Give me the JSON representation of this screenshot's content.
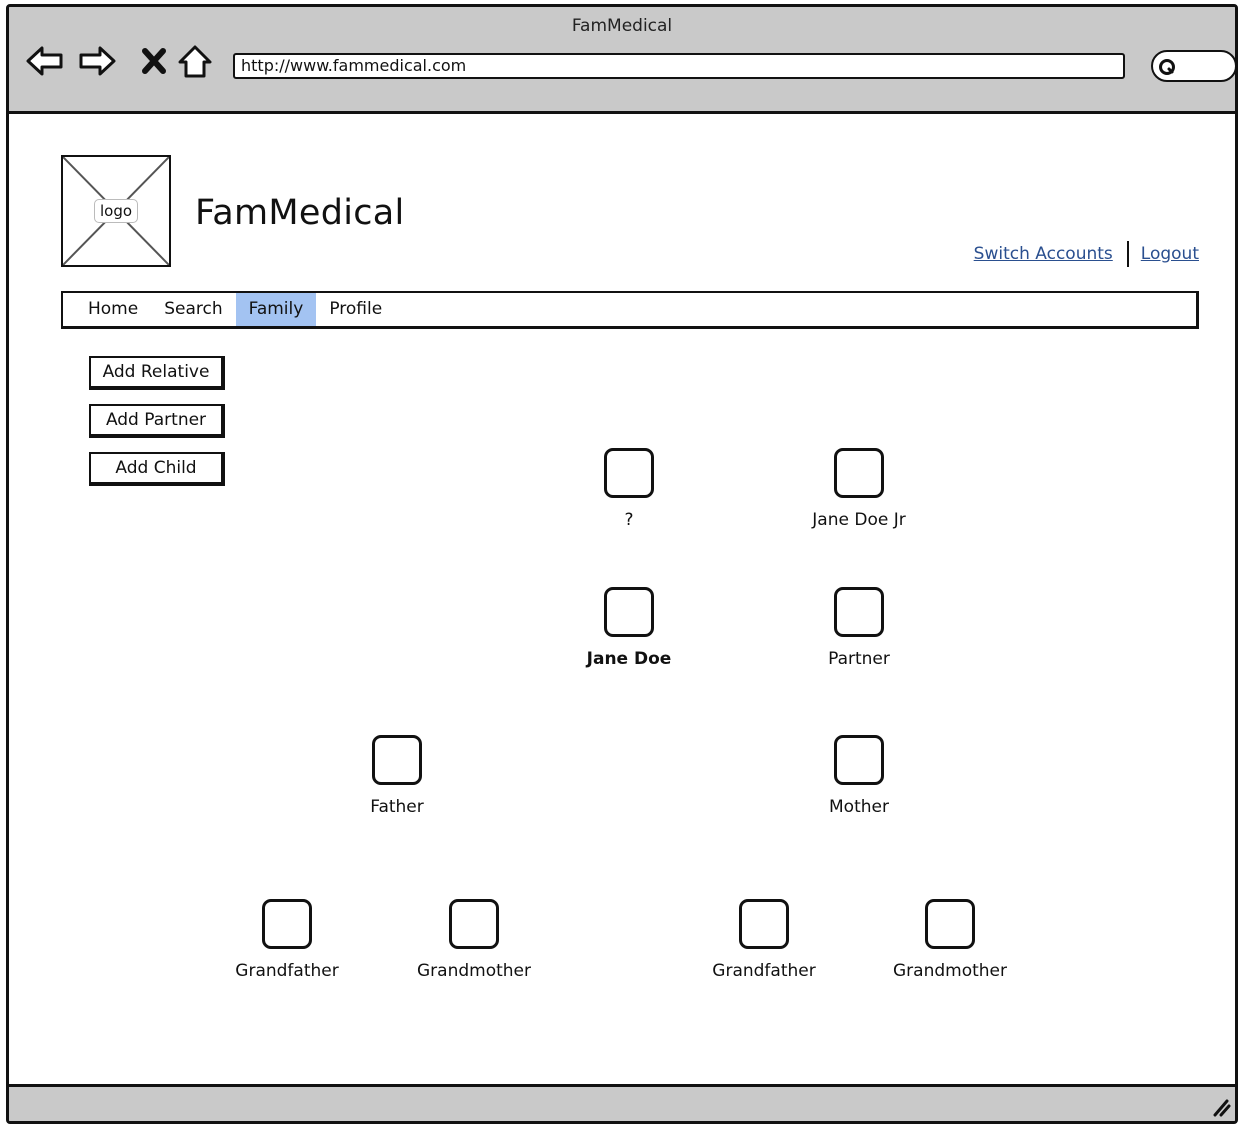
{
  "browser": {
    "window_title": "FamMedical",
    "url": "http://www.fammedical.com",
    "icons": [
      "back-arrow-icon",
      "forward-arrow-icon",
      "close-x-icon",
      "home-icon",
      "search-icon"
    ]
  },
  "header": {
    "logo_label": "logo",
    "app_title": "FamMedical",
    "links": {
      "switch_accounts": "Switch Accounts",
      "logout": "Logout"
    }
  },
  "nav": {
    "tabs": [
      {
        "label": "Home",
        "active": false
      },
      {
        "label": "Search",
        "active": false
      },
      {
        "label": "Family",
        "active": true
      },
      {
        "label": "Profile",
        "active": false
      }
    ],
    "active_color": "#a3c3f2"
  },
  "actions": {
    "add_relative": "Add Relative",
    "add_partner": "Add Partner",
    "add_child": "Add Child"
  },
  "family_tree": {
    "child_unknown": "?",
    "child": "Jane Doe Jr",
    "self": "Jane Doe",
    "partner": "Partner",
    "father": "Father",
    "mother": "Mother",
    "paternal_grandfather": "Grandfather",
    "paternal_grandmother": "Grandmother",
    "maternal_grandfather": "Grandfather",
    "maternal_grandmother": "Grandmother"
  }
}
